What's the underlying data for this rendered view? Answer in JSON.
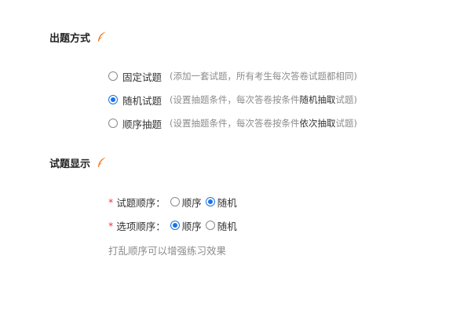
{
  "section1": {
    "title": "出题方式",
    "options": [
      {
        "label": "固定试题",
        "hint_pre": "(添加一套试题，所有考生每次答卷试题都相同)",
        "hint_hl": "",
        "hint_post": "",
        "checked": false
      },
      {
        "label": "随机试题",
        "hint_pre": "(设置抽题条件，每次答卷按条件",
        "hint_hl": "随机抽取",
        "hint_post": "试题)",
        "checked": true
      },
      {
        "label": "顺序抽题",
        "hint_pre": "(设置抽题条件，每次答卷按条件",
        "hint_hl": "依次抽取",
        "hint_post": "试题)",
        "checked": false
      }
    ]
  },
  "section2": {
    "title": "试题显示",
    "question_order": {
      "required_mark": "*",
      "label": "试题顺序：",
      "option_a": "顺序",
      "option_b": "随机",
      "selected": "随机"
    },
    "option_order": {
      "required_mark": "*",
      "label": "选项顺序：",
      "option_a": "顺序",
      "option_b": "随机",
      "selected": "顺序"
    },
    "note": "打乱顺序可以增强练习效果"
  },
  "colors": {
    "accent": "#1a73e8",
    "icon": "#f47b20",
    "required": "#e53935",
    "hint": "#8c8c8c"
  }
}
